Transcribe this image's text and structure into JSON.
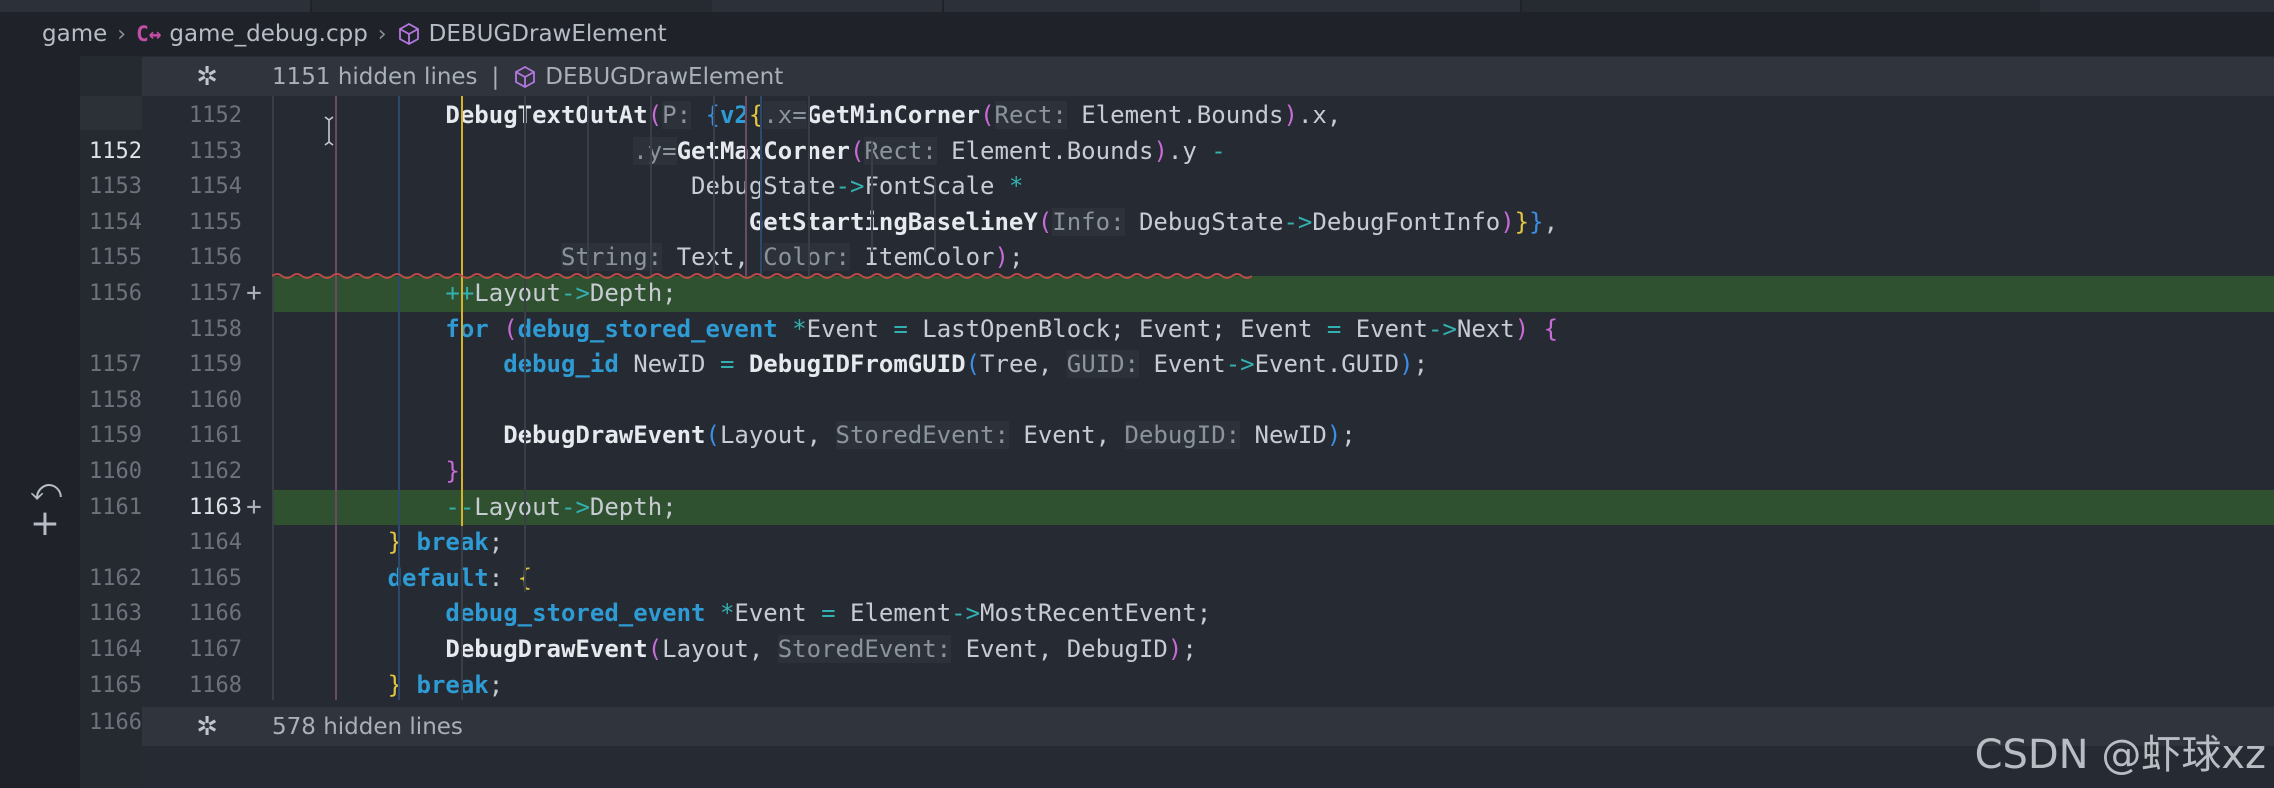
{
  "breadcrumb": {
    "folder": "game",
    "file_badge": "C↔",
    "file": "game_debug.cpp",
    "symbol": "DEBUGDrawElement"
  },
  "hidden_top": {
    "label": "1151 hidden lines",
    "symbol": "DEBUGDrawElement"
  },
  "hidden_bottom": {
    "label": "578 hidden lines"
  },
  "old_last_line": "1166",
  "icons": [
    "gear-fold-icon",
    "cube-icon",
    "cpp-file-icon",
    "revert-icon",
    "plus-icon",
    "text-cursor-icon"
  ],
  "rows": [
    {
      "old": "",
      "new": "1152",
      "plus": "",
      "added": false
    },
    {
      "old": "1152",
      "new": "1153",
      "plus": "",
      "added": false,
      "cur_old": true
    },
    {
      "old": "1153",
      "new": "1154",
      "plus": "",
      "added": false
    },
    {
      "old": "1154",
      "new": "1155",
      "plus": "",
      "added": false
    },
    {
      "old": "1155",
      "new": "1156",
      "plus": "",
      "added": false
    },
    {
      "old": "1156",
      "new": "1157",
      "plus": "+",
      "added": true
    },
    {
      "old": "",
      "new": "1158",
      "plus": "",
      "added": false
    },
    {
      "old": "1157",
      "new": "1159",
      "plus": "",
      "added": false
    },
    {
      "old": "1158",
      "new": "1160",
      "plus": "",
      "added": false
    },
    {
      "old": "1159",
      "new": "1161",
      "plus": "",
      "added": false
    },
    {
      "old": "1160",
      "new": "1162",
      "plus": "",
      "added": false
    },
    {
      "old": "1161",
      "new": "1163",
      "plus": "+",
      "added": true,
      "cur_new": true
    },
    {
      "old": "",
      "new": "1164",
      "plus": "",
      "added": false
    },
    {
      "old": "1162",
      "new": "1165",
      "plus": "",
      "added": false
    },
    {
      "old": "1163",
      "new": "1166",
      "plus": "",
      "added": false
    },
    {
      "old": "1164",
      "new": "1167",
      "plus": "",
      "added": false
    },
    {
      "old": "1165",
      "new": "1168",
      "plus": "",
      "added": false
    }
  ],
  "code": [
    [
      [
        "",
        "            "
      ],
      [
        "fn",
        "DebugTextOutAt"
      ],
      [
        "pk",
        "("
      ],
      [
        "hint",
        "P:"
      ],
      [
        "",
        " "
      ],
      [
        "bl",
        "{"
      ],
      [
        "ty",
        "v2"
      ],
      [
        "yl",
        "{"
      ],
      [
        "hint",
        ".x="
      ],
      [
        "fn",
        "GetMinCorner"
      ],
      [
        "pk",
        "("
      ],
      [
        "hint",
        "Rect:"
      ],
      [
        "",
        " Element.Bounds"
      ],
      [
        "pk",
        ")"
      ],
      [
        "",
        ".x,"
      ]
    ],
    [
      [
        "",
        "                         "
      ],
      [
        "hint",
        ".y="
      ],
      [
        "fn",
        "GetMaxCorner"
      ],
      [
        "pk",
        "("
      ],
      [
        "hint",
        "Rect:"
      ],
      [
        "",
        " Element.Bounds"
      ],
      [
        "pk",
        ")"
      ],
      [
        "",
        ".y "
      ],
      [
        "op",
        "-"
      ]
    ],
    [
      [
        "",
        "                             DebugState"
      ],
      [
        "op",
        "->"
      ],
      [
        "",
        "FontScale "
      ],
      [
        "op",
        "*"
      ]
    ],
    [
      [
        "",
        "                                 "
      ],
      [
        "fn",
        "GetStartingBaselineY"
      ],
      [
        "pk",
        "("
      ],
      [
        "hint",
        "Info:"
      ],
      [
        "",
        " DebugState"
      ],
      [
        "op",
        "->"
      ],
      [
        "",
        "DebugFontInfo"
      ],
      [
        "pk",
        ")"
      ],
      [
        "yl",
        "}"
      ],
      [
        "bl",
        "}"
      ],
      [
        "",
        ","
      ]
    ],
    [
      [
        "",
        "                    "
      ],
      [
        "hint",
        "String:"
      ],
      [
        "",
        " Text, "
      ],
      [
        "hint",
        "Color:"
      ],
      [
        "",
        " ItemColor"
      ],
      [
        "pk",
        ")"
      ],
      [
        "",
        ";"
      ]
    ],
    [
      [
        "",
        "            "
      ],
      [
        "op",
        "++"
      ],
      [
        "",
        "Layout"
      ],
      [
        "op",
        "->"
      ],
      [
        "",
        "Depth;"
      ]
    ],
    [
      [
        "",
        "            "
      ],
      [
        "kw",
        "for"
      ],
      [
        "",
        " "
      ],
      [
        "pk",
        "("
      ],
      [
        "ty",
        "debug_stored_event"
      ],
      [
        "",
        " "
      ],
      [
        "op",
        "*"
      ],
      [
        "",
        "Event "
      ],
      [
        "op",
        "="
      ],
      [
        "",
        " LastOpenBlock; Event; Event "
      ],
      [
        "op",
        "="
      ],
      [
        "",
        " Event"
      ],
      [
        "op",
        "->"
      ],
      [
        "",
        "Next"
      ],
      [
        "pk",
        ")"
      ],
      [
        "",
        " "
      ],
      [
        "pk",
        "{"
      ]
    ],
    [
      [
        "",
        "                "
      ],
      [
        "ty",
        "debug_id"
      ],
      [
        "",
        " NewID "
      ],
      [
        "op",
        "="
      ],
      [
        "",
        " "
      ],
      [
        "fn",
        "DebugIDFromGUID"
      ],
      [
        "bl",
        "("
      ],
      [
        "",
        "Tree, "
      ],
      [
        "hint",
        "GUID:"
      ],
      [
        "",
        " Event"
      ],
      [
        "op",
        "->"
      ],
      [
        "",
        "Event.GUID"
      ],
      [
        "bl",
        ")"
      ],
      [
        "",
        ";"
      ]
    ],
    [],
    [
      [
        "",
        "                "
      ],
      [
        "fn",
        "DebugDrawEvent"
      ],
      [
        "bl",
        "("
      ],
      [
        "",
        "Layout, "
      ],
      [
        "hint",
        "StoredEvent:"
      ],
      [
        "",
        " Event, "
      ],
      [
        "hint",
        "DebugID:"
      ],
      [
        "",
        " NewID"
      ],
      [
        "bl",
        ")"
      ],
      [
        "",
        ";"
      ]
    ],
    [
      [
        "",
        "            "
      ],
      [
        "pk",
        "}"
      ]
    ],
    [
      [
        "",
        "            "
      ],
      [
        "op",
        "--"
      ],
      [
        "",
        "Layout"
      ],
      [
        "op",
        "->"
      ],
      [
        "",
        "Depth;"
      ]
    ],
    [
      [
        "",
        "        "
      ],
      [
        "yl",
        "}"
      ],
      [
        "",
        " "
      ],
      [
        "kw",
        "break"
      ],
      [
        "",
        ";"
      ]
    ],
    [
      [
        "",
        "        "
      ],
      [
        "kw",
        "default"
      ],
      [
        "",
        ": "
      ],
      [
        "yl",
        "{"
      ]
    ],
    [
      [
        "",
        "            "
      ],
      [
        "ty",
        "debug_stored_event"
      ],
      [
        "",
        " "
      ],
      [
        "op",
        "*"
      ],
      [
        "",
        "Event "
      ],
      [
        "op",
        "="
      ],
      [
        "",
        " Element"
      ],
      [
        "op",
        "->"
      ],
      [
        "",
        "MostRecentEvent;"
      ]
    ],
    [
      [
        "",
        "            "
      ],
      [
        "fn",
        "DebugDrawEvent"
      ],
      [
        "pk",
        "("
      ],
      [
        "",
        "Layout, "
      ],
      [
        "hint",
        "StoredEvent:"
      ],
      [
        "",
        " Event, DebugID"
      ],
      [
        "pk",
        ")"
      ],
      [
        "",
        ";"
      ]
    ],
    [
      [
        "",
        "        "
      ],
      [
        "yl",
        "}"
      ],
      [
        "",
        " "
      ],
      [
        "kw",
        "break"
      ],
      [
        "",
        ";"
      ]
    ]
  ],
  "watermark": "CSDN @虾球xz"
}
